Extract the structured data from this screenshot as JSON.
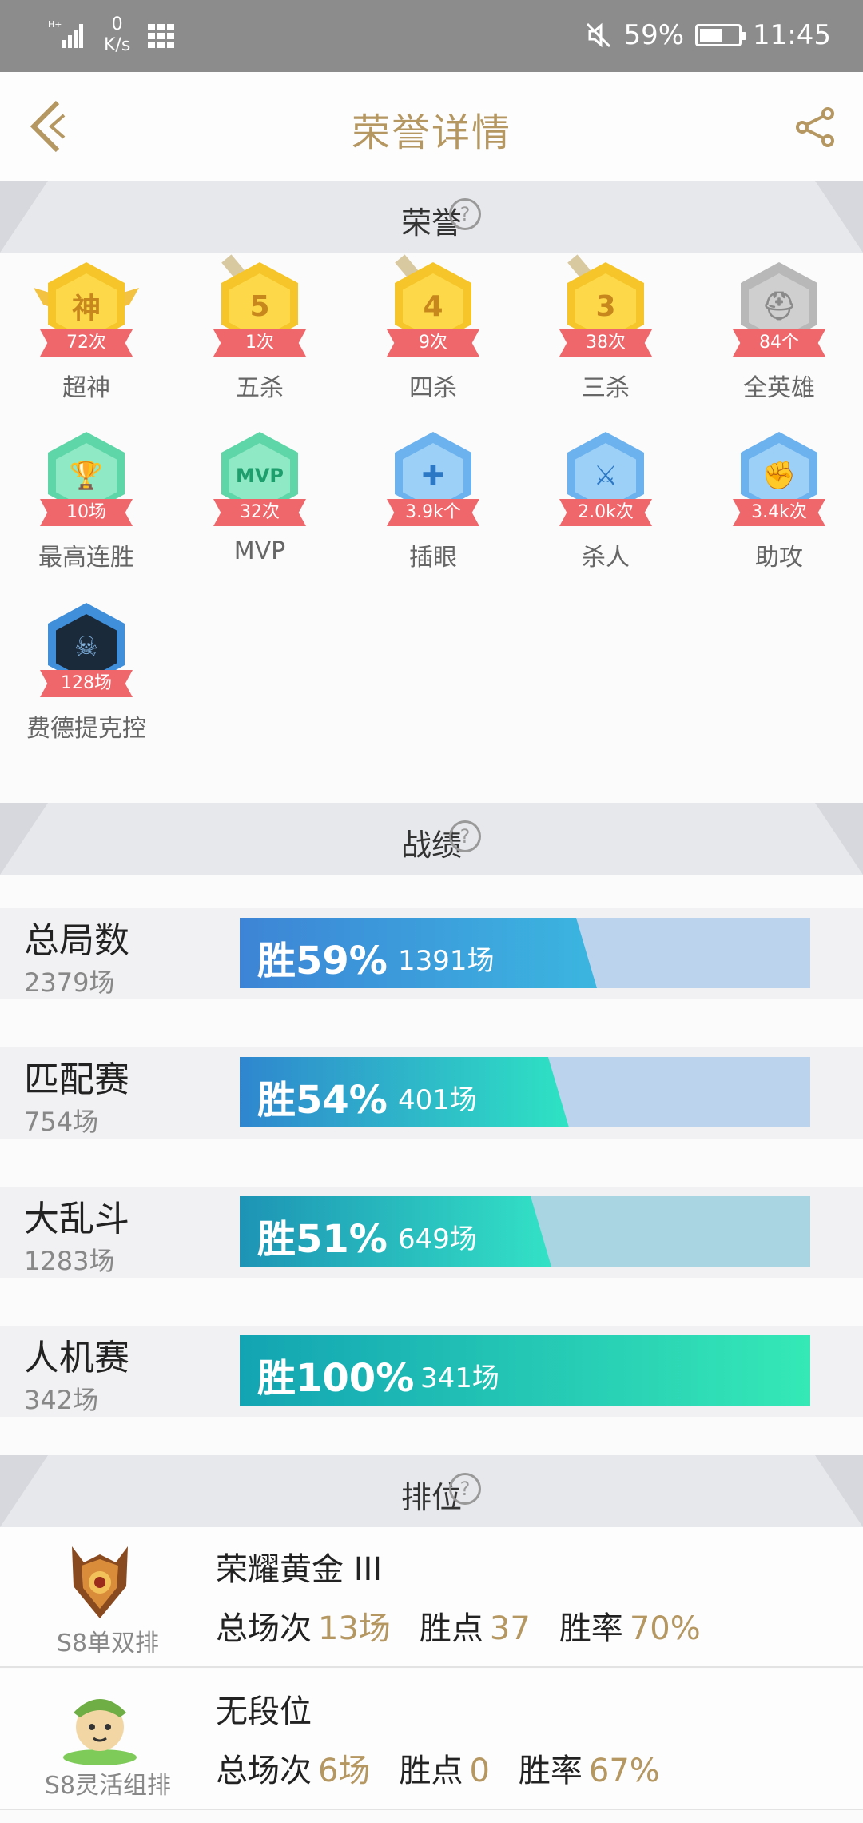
{
  "status_bar": {
    "network_type": "H+",
    "speed_value": "0",
    "speed_unit": "K/s",
    "battery": "59%",
    "battery_level": 0.59,
    "time": "11:45"
  },
  "header": {
    "title": "荣誉详情"
  },
  "sections": {
    "honor": "荣誉",
    "record": "战绩",
    "ranked": "排位",
    "help_glyph": "?"
  },
  "honors": [
    {
      "icon": "神",
      "badge": "72次",
      "name": "超神",
      "style": "gold"
    },
    {
      "icon": "5",
      "badge": "1次",
      "name": "五杀",
      "style": "gold"
    },
    {
      "icon": "4",
      "badge": "9次",
      "name": "四杀",
      "style": "gold"
    },
    {
      "icon": "3",
      "badge": "38次",
      "name": "三杀",
      "style": "gold"
    },
    {
      "icon": "helmet-icon",
      "badge": "84个",
      "name": "全英雄",
      "style": "grey"
    },
    {
      "icon": "trophy-icon",
      "badge": "10场",
      "name": "最高连胜",
      "style": "green"
    },
    {
      "icon": "MVP",
      "badge": "32次",
      "name": "MVP",
      "style": "green"
    },
    {
      "icon": "ward-icon",
      "badge": "3.9k个",
      "name": "插眼",
      "style": "blue"
    },
    {
      "icon": "kill-icon",
      "badge": "2.0k次",
      "name": "杀人",
      "style": "blue"
    },
    {
      "icon": "assist-icon",
      "badge": "3.4k次",
      "name": "助攻",
      "style": "blue"
    },
    {
      "icon": "champion-portrait-icon",
      "badge": "128场",
      "name": "费德提克控",
      "style": "dark"
    }
  ],
  "stats": [
    {
      "label": "总局数",
      "total": "2379场",
      "win_rate_text": "胜59%",
      "wins": "1391场",
      "win_rate": 0.59,
      "fill_from": "#3d84d6",
      "fill_to": "#3bb6e0",
      "track": "#bcd3ee"
    },
    {
      "label": "匹配赛",
      "total": "754场",
      "win_rate_text": "胜54%",
      "wins": "401场",
      "win_rate": 0.54,
      "fill_from": "#2f86cf",
      "fill_to": "#2ee3c3",
      "track": "#bcd3ee"
    },
    {
      "label": "大乱斗",
      "total": "1283场",
      "win_rate_text": "胜51%",
      "wins": "649场",
      "win_rate": 0.51,
      "fill_from": "#1d93b5",
      "fill_to": "#33e2c6",
      "track": "#a9d5e3"
    },
    {
      "label": "人机赛",
      "total": "342场",
      "win_rate_text": "胜100%",
      "wins": "341场",
      "win_rate": 1.0,
      "fill_from": "#13a4b3",
      "fill_to": "#35e9b6",
      "track": "#a9d5e3"
    }
  ],
  "ranked": [
    {
      "queue": "S8单双排",
      "tier": "荣耀黄金 III",
      "games_label": "总场次",
      "games": "13场",
      "points_label": "胜点",
      "points": "37",
      "rate_label": "胜率",
      "rate": "70%",
      "emblem": "gold-rank-emblem-icon"
    },
    {
      "queue": "S8灵活组排",
      "tier": "无段位",
      "games_label": "总场次",
      "games": "6场",
      "points_label": "胜点",
      "points": "0",
      "rate_label": "胜率",
      "rate": "67%",
      "emblem": "unranked-teemo-emblem-icon"
    }
  ],
  "colors": {
    "accent_gold": "#b59762",
    "ribbon_red": "#f0676b"
  }
}
